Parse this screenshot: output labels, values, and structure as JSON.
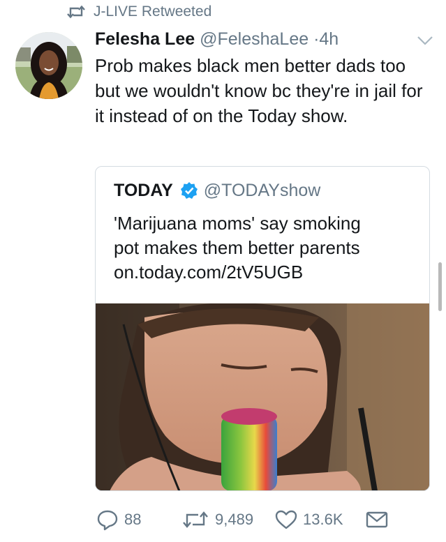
{
  "retweet": {
    "label": "J-LIVE Retweeted",
    "icon": "retweet-icon"
  },
  "tweet": {
    "author_name": "Felesha Lee",
    "handle": "@FeleshaLee",
    "separator": "·",
    "time": "4h",
    "text": "Prob makes black men better dads too but we wouldn't know bc they're in jail for it instead of on the Today show."
  },
  "quoted": {
    "author_name": "TODAY",
    "handle": "@TODAYshow",
    "text_line1": "'Marijuana moms' say smoking",
    "text_line2": "pot makes them better parents",
    "link": "on.today.com/2tV5UGB"
  },
  "actions": {
    "reply_count": "88",
    "retweet_count": "9,489",
    "like_count": "13.6K"
  },
  "colors": {
    "text": "#14171a",
    "secondary": "#657786",
    "verified": "#1da1f2",
    "border": "#d4dbe1"
  }
}
